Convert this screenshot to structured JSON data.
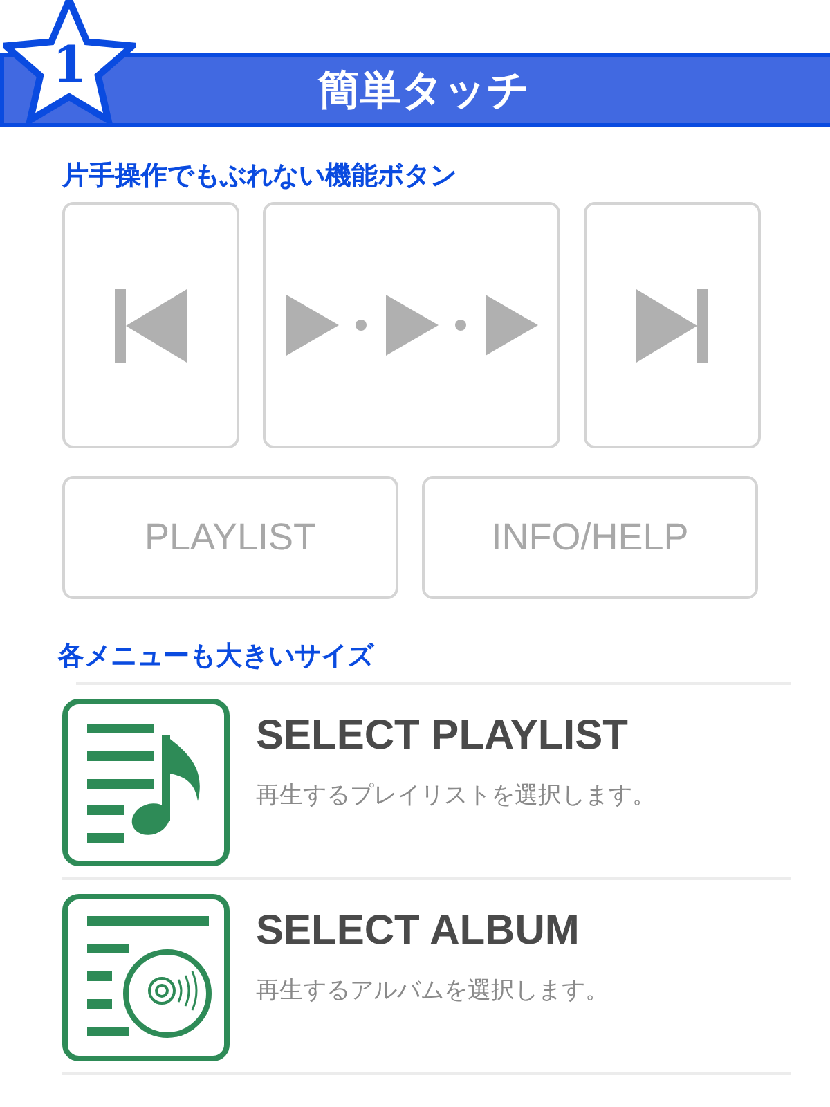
{
  "header": {
    "badge": "1",
    "title": "簡単タッチ"
  },
  "sections": [
    {
      "heading": "片手操作でもぶれない機能ボタン",
      "transport": [
        {
          "kind": "previous"
        },
        {
          "kind": "play"
        },
        {
          "kind": "next"
        }
      ],
      "buttons": [
        "PLAYLIST",
        "INFO/HELP"
      ]
    },
    {
      "heading": "各メニューも大きいサイズ",
      "menu": [
        {
          "kind": "playlist",
          "title": "SELECT PLAYLIST",
          "description": "再生するプレイリストを選択します。"
        },
        {
          "kind": "album",
          "title": "SELECT ALBUM",
          "description": "再生するアルバムを選択します。"
        }
      ]
    }
  ]
}
